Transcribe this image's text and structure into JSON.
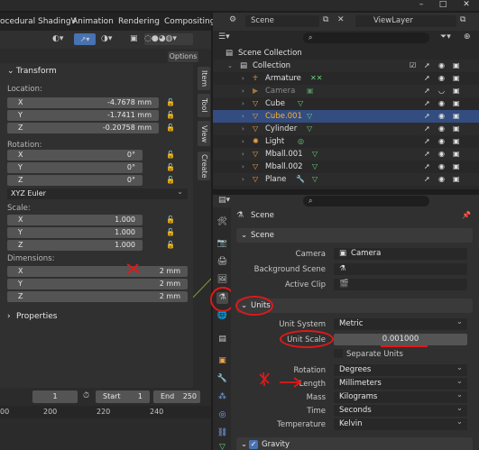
{
  "window": {
    "min": "–",
    "max": "□",
    "close": "✕"
  },
  "workspace_tabs": [
    "ocedural ShadingV",
    "Animation",
    "Rendering",
    "Compositing"
  ],
  "viewport": {
    "options": "Options"
  },
  "npanel": {
    "title": "Transform",
    "location": {
      "label": "Location:",
      "rows": [
        {
          "axis": "X",
          "value": "-4.7678 mm"
        },
        {
          "axis": "Y",
          "value": "-1.7411 mm"
        },
        {
          "axis": "Z",
          "value": "-0.20758 mm"
        }
      ]
    },
    "rotation": {
      "label": "Rotation:",
      "rows": [
        {
          "axis": "X",
          "value": "0°"
        },
        {
          "axis": "Y",
          "value": "0°"
        },
        {
          "axis": "Z",
          "value": "0°"
        }
      ],
      "mode": "XYZ Euler"
    },
    "scale": {
      "label": "Scale:",
      "rows": [
        {
          "axis": "X",
          "value": "1.000"
        },
        {
          "axis": "Y",
          "value": "1.000"
        },
        {
          "axis": "Z",
          "value": "1.000"
        }
      ]
    },
    "dimensions": {
      "label": "Dimensions:",
      "rows": [
        {
          "axis": "X",
          "value": "2 mm"
        },
        {
          "axis": "Y",
          "value": "2 mm"
        },
        {
          "axis": "Z",
          "value": "2 mm"
        }
      ]
    },
    "properties_label": "Properties",
    "vtabs": [
      "Item",
      "Tool",
      "View",
      "Create"
    ]
  },
  "timeline": {
    "frame": "1",
    "start_label": "Start",
    "start": "1",
    "end_label": "End",
    "end": "250",
    "ruler": [
      "00",
      "200",
      "220",
      "240"
    ]
  },
  "outliner": {
    "scene": "Scene",
    "viewlayer": "ViewLayer",
    "collection_root": "Scene Collection",
    "collection": "Collection",
    "items": [
      "Armature",
      "Camera",
      "Cube",
      "Cube.001",
      "Cylinder",
      "Light",
      "Mball.001",
      "Mball.002",
      "Plane"
    ]
  },
  "properties": {
    "context": "Scene",
    "scene_section": "Scene",
    "camera_label": "Camera",
    "camera_value": "Camera",
    "bg_label": "Background Scene",
    "clip_label": "Active Clip",
    "units_section": "Units",
    "unit_system_label": "Unit System",
    "unit_system": "Metric",
    "unit_scale_label": "Unit Scale",
    "unit_scale": "0.001000",
    "separate_units": "Separate Units",
    "rotation_label": "Rotation",
    "rotation": "Degrees",
    "length_label": "Length",
    "length": "Millimeters",
    "mass_label": "Mass",
    "mass": "Kilograms",
    "time_label": "Time",
    "time": "Seconds",
    "temperature_label": "Temperature",
    "temperature": "Kelvin",
    "gravity_section": "Gravity"
  },
  "colors": {
    "selection": "#334d80",
    "annotation": "#e01919",
    "object_icon": "#f5a34a",
    "data_icon": "#6ad27a"
  }
}
